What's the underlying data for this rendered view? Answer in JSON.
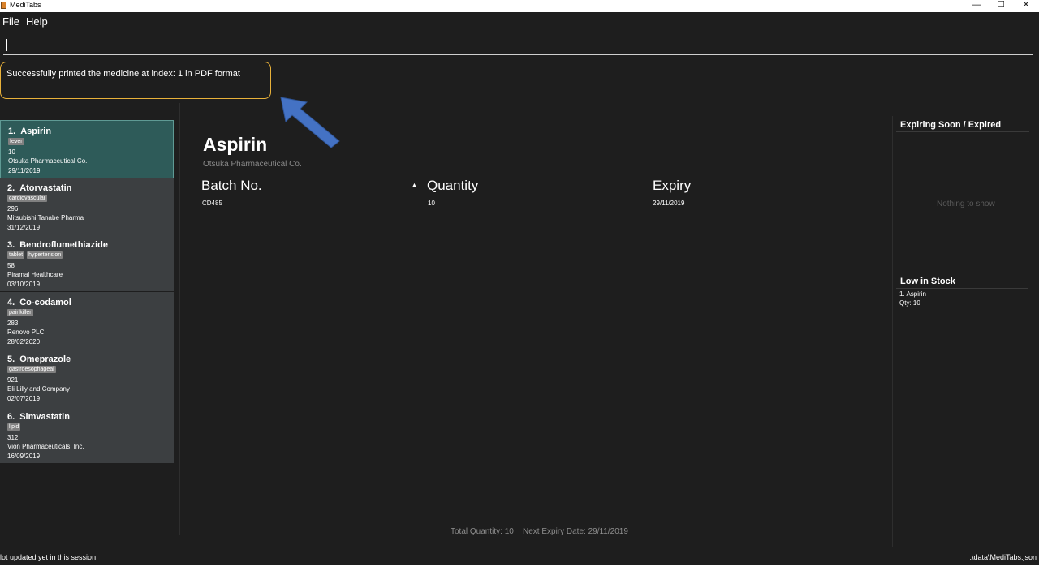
{
  "window": {
    "title": "MediTabs"
  },
  "menu": {
    "file": "File",
    "help": "Help"
  },
  "command_box": {
    "value": ""
  },
  "result_message": "Successfully printed the medicine at index: 1 in PDF format",
  "medicines": [
    {
      "index": "1.",
      "name": "Aspirin",
      "tags": [
        "fever"
      ],
      "quantity": "10",
      "company": "Otsuka Pharmaceutical Co.",
      "expiry": "29/11/2019",
      "selected": true
    },
    {
      "index": "2.",
      "name": "Atorvastatin",
      "tags": [
        "cardiovascular"
      ],
      "quantity": "296",
      "company": "Mitsubishi Tanabe Pharma",
      "expiry": "31/12/2019"
    },
    {
      "index": "3.",
      "name": "Bendroflumethiazide",
      "tags": [
        "tablet",
        "hypertension"
      ],
      "quantity": "58",
      "company": "Piramal Healthcare",
      "expiry": "03/10/2019"
    },
    {
      "index": "4.",
      "name": "Co-codamol",
      "tags": [
        "painkiller"
      ],
      "quantity": "283",
      "company": "Renovo PLC",
      "expiry": "28/02/2020"
    },
    {
      "index": "5.",
      "name": "Omeprazole",
      "tags": [
        "gastroesophageal"
      ],
      "quantity": "921",
      "company": "Eli Lilly and Company",
      "expiry": "02/07/2019"
    },
    {
      "index": "6.",
      "name": "Simvastatin",
      "tags": [
        "lipid"
      ],
      "quantity": "312",
      "company": "Vion Pharmaceuticals, Inc.",
      "expiry": "16/09/2019"
    }
  ],
  "detail": {
    "name": "Aspirin",
    "company": "Otsuka Pharmaceutical Co.",
    "columns": [
      "Batch No.",
      "Quantity",
      "Expiry"
    ],
    "rows": [
      {
        "batch": "CD485",
        "quantity": "10",
        "expiry": "29/11/2019"
      }
    ],
    "total_quantity": "Total Quantity: 10",
    "next_expiry": "Next Expiry Date: 29/11/2019"
  },
  "side": {
    "expiring_title": "Expiring Soon / Expired",
    "expiring_empty": "Nothing to show",
    "low_stock_title": "Low in Stock",
    "low_stock_items": [
      {
        "name": "1. Aspirin",
        "qty": "Qty: 10"
      }
    ]
  },
  "status": {
    "left": "lot updated yet in this session",
    "right": ".\\data\\MediTabs.json"
  },
  "colors": {
    "background": "#1e1e1e",
    "card": "#3c3f41",
    "card_selected": "#2e5b59",
    "tag": "#808080",
    "result_border": "#e8b13a",
    "arrow": "#4472c4"
  }
}
